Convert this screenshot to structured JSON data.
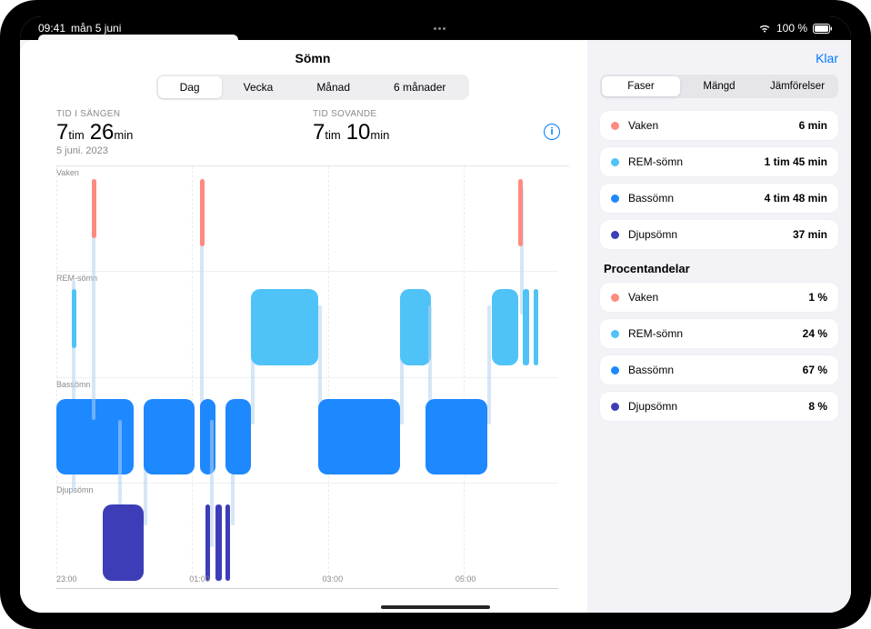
{
  "status": {
    "time": "09:41",
    "date": "mån 5 juni",
    "battery": "100 %"
  },
  "page": {
    "title": "Sömn",
    "done": "Klar"
  },
  "period_tabs": {
    "items": [
      "Dag",
      "Vecka",
      "Månad",
      "6 månader"
    ],
    "active": 0
  },
  "summary": {
    "in_bed_label": "TID I SÄNGEN",
    "in_bed_h": "7",
    "in_bed_h_unit": "tim",
    "in_bed_m": "26",
    "in_bed_m_unit": "min",
    "asleep_label": "TID SOVANDE",
    "asleep_h": "7",
    "asleep_h_unit": "tim",
    "asleep_m": "10",
    "asleep_m_unit": "min",
    "date": "5 juni. 2023"
  },
  "lanes": {
    "awake": "Vaken",
    "rem": "REM-sömn",
    "core": "Bassömn",
    "deep": "Djupsömn"
  },
  "x_ticks": [
    "23:00",
    "01:00",
    "03:00",
    "05:00"
  ],
  "side_tabs": {
    "items": [
      "Faser",
      "Mängd",
      "Jämförelser"
    ],
    "active": 0
  },
  "stages": {
    "durations": [
      {
        "key": "awake",
        "label": "Vaken",
        "value": "6 min",
        "color": "#ff8a80"
      },
      {
        "key": "rem",
        "label": "REM-sömn",
        "value": "1 tim 45 min",
        "color": "#4fc3f7"
      },
      {
        "key": "core",
        "label": "Bassömn",
        "value": "4 tim 48 min",
        "color": "#1e88ff"
      },
      {
        "key": "deep",
        "label": "Djupsömn",
        "value": "37 min",
        "color": "#3d3db8"
      }
    ],
    "percent_title": "Procentandelar",
    "percents": [
      {
        "key": "awake",
        "label": "Vaken",
        "value": "1 %",
        "color": "#ff8a80"
      },
      {
        "key": "rem",
        "label": "REM-sömn",
        "value": "24 %",
        "color": "#4fc3f7"
      },
      {
        "key": "core",
        "label": "Bassömn",
        "value": "67 %",
        "color": "#1e88ff"
      },
      {
        "key": "deep",
        "label": "Djupsömn",
        "value": "8 %",
        "color": "#3d3db8"
      }
    ]
  },
  "chart_data": {
    "type": "area",
    "title": "Sömn",
    "x_start": "23:00",
    "x_end": "06:30",
    "lanes": [
      "Vaken",
      "REM-sömn",
      "Bassömn",
      "Djupsömn"
    ],
    "x_ticks": [
      "23:00",
      "01:00",
      "03:00",
      "05:00"
    ],
    "segments": [
      {
        "lane": "REM-sömn",
        "x": 3,
        "w": 2,
        "thin": true
      },
      {
        "lane": "Bassömn",
        "x": 0,
        "w": 15
      },
      {
        "lane": "Vaken",
        "x": 7,
        "w": 1,
        "thin": true
      },
      {
        "lane": "Djupsömn",
        "x": 9,
        "w": 8
      },
      {
        "lane": "Bassömn",
        "x": 17,
        "w": 10
      },
      {
        "lane": "Vaken",
        "x": 28,
        "w": 1,
        "thin": true
      },
      {
        "lane": "Bassömn",
        "x": 28,
        "w": 3
      },
      {
        "lane": "Djupsömn",
        "x": 29,
        "w": 1,
        "thin": true
      },
      {
        "lane": "Djupsömn",
        "x": 31,
        "w": 2,
        "thin": true
      },
      {
        "lane": "Djupsömn",
        "x": 33,
        "w": 1,
        "thin": true
      },
      {
        "lane": "Bassömn",
        "x": 33,
        "w": 5
      },
      {
        "lane": "REM-sömn",
        "x": 38,
        "w": 13
      },
      {
        "lane": "Bassömn",
        "x": 51,
        "w": 16
      },
      {
        "lane": "REM-sömn",
        "x": 67,
        "w": 6
      },
      {
        "lane": "Bassömn",
        "x": 72,
        "w": 12
      },
      {
        "lane": "REM-sömn",
        "x": 85,
        "w": 5
      },
      {
        "lane": "Vaken",
        "x": 90,
        "w": 1,
        "thin": true
      },
      {
        "lane": "REM-sömn",
        "x": 91,
        "w": 2,
        "thin": true
      },
      {
        "lane": "REM-sömn",
        "x": 93,
        "w": 1,
        "thin": true
      }
    ]
  }
}
